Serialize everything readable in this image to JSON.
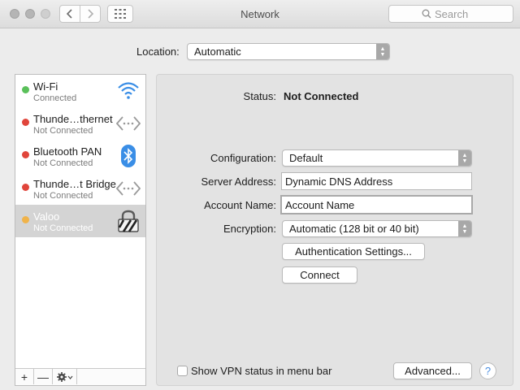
{
  "window": {
    "title": "Network"
  },
  "toolbar": {
    "search_placeholder": "Search"
  },
  "location": {
    "label": "Location:",
    "value": "Automatic"
  },
  "services": [
    {
      "name": "Wi-Fi",
      "status": "Connected",
      "dot_color": "#5ac05a",
      "icon": "wifi-icon"
    },
    {
      "name": "Thunde…thernet",
      "status": "Not Connected",
      "dot_color": "#e0453b",
      "icon": "ethernet-arrows-icon"
    },
    {
      "name": "Bluetooth PAN",
      "status": "Not Connected",
      "dot_color": "#e0453b",
      "icon": "bluetooth-icon"
    },
    {
      "name": "Thunde…t Bridge",
      "status": "Not Connected",
      "dot_color": "#e0453b",
      "icon": "ethernet-arrows-icon"
    },
    {
      "name": "Valoo",
      "status": "Not Connected",
      "dot_color": "#f0b34a",
      "icon": "vpn-lock-icon"
    }
  ],
  "sidebar_controls": {
    "add": "+",
    "remove": "—"
  },
  "detail": {
    "status_label": "Status:",
    "status_value": "Not Connected",
    "configuration_label": "Configuration:",
    "configuration_value": "Default",
    "server_label": "Server Address:",
    "server_value": "Dynamic DNS Address",
    "account_label": "Account Name:",
    "account_value": "Account Name",
    "encryption_label": "Encryption:",
    "encryption_value": "Automatic (128 bit or 40 bit)",
    "auth_button": "Authentication Settings...",
    "connect_button": "Connect"
  },
  "footer": {
    "show_vpn_label": "Show VPN status in menu bar",
    "show_vpn_checked": false,
    "advanced_button": "Advanced...",
    "help_button": "?"
  },
  "colors": {
    "status_connected": "#5ac05a",
    "status_disconnected": "#e0453b",
    "status_inactive": "#f0b34a",
    "accent": "#3a8ee6"
  }
}
